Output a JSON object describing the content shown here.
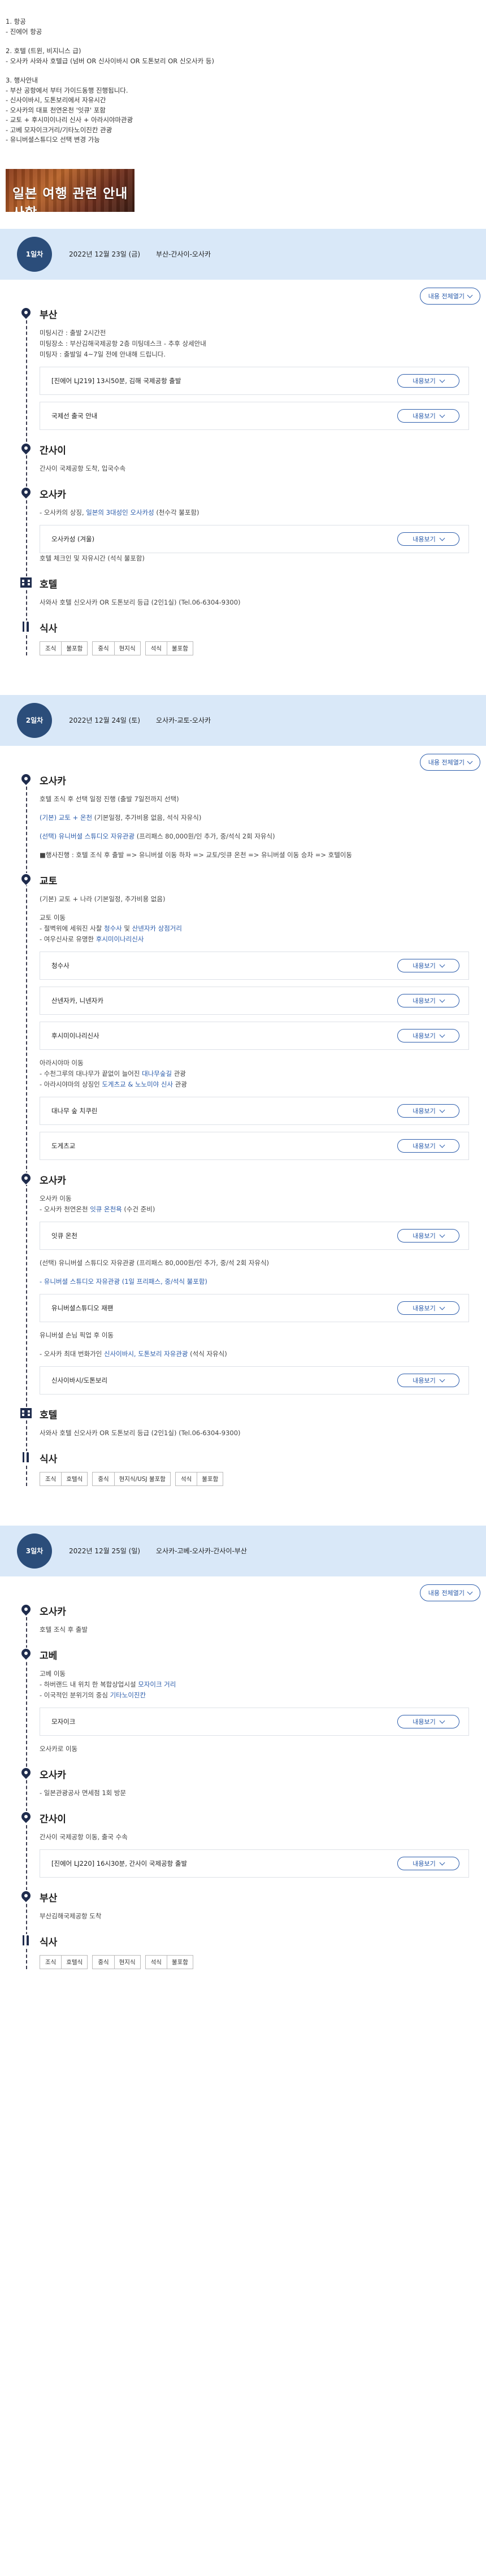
{
  "intro": {
    "lines": [
      "1. 항공",
      "- 진에어 항공",
      "",
      "2. 호텔 (트윈, 비지니스 급)",
      "- 오사카 사와사 호텔급 (넘버 OR 신사이바시 OR 도톤보리 OR 신오사카 등)",
      "",
      "3. 행사안내",
      "- 부산 공항에서 부터 가이드동행 진행됩니다.",
      "- 신사이바시, 도톤보리에서 자유시간",
      "- 오사카의 대표 천연온천 '잇큐' 포함",
      "- 교토 + 후시미이나리 신사 + 아라시야마관광",
      "- 고베 모자이크거리/기타노이진칸 관광",
      "- 유니버셜스튜디오 선택 변경 가능"
    ]
  },
  "notice_banner": {
    "text": "일본 여행 관련 안내사항"
  },
  "expand_all_label": "내용 전체열기",
  "more_label": "내용보기",
  "days": [
    {
      "badge": "1일차",
      "date": "2022년 12월 23일 (금)",
      "route": "부산-간사이-오사카",
      "places": [
        {
          "type": "place",
          "title": "부산",
          "blocks": [
            {
              "kind": "text",
              "lines": [
                "미팅시간 : 출발 2시간전",
                "미팅장소 : 부산김해국제공항 2층 미팅데스크 - 추후 상세안내",
                "미팅자 : 출발일 4~7일 전에 안내해 드립니다."
              ]
            },
            {
              "kind": "box",
              "label": "[진에어 LJ219] 13시50분, 김해 국제공항 출발"
            },
            {
              "kind": "box",
              "label": "국제선 출국 안내"
            }
          ]
        },
        {
          "type": "place",
          "title": "간사이",
          "blocks": [
            {
              "kind": "text",
              "lines": [
                "간사이 국제공항 도착, 입국수속"
              ]
            }
          ]
        },
        {
          "type": "place",
          "title": "오사카",
          "blocks": [
            {
              "kind": "rich",
              "segments": [
                [
                  "- 오사카의 상징, ",
                  ""
                ],
                [
                  "일본의 3대성인 오사카성",
                  "blue"
                ],
                [
                  " (천수각 불포함)",
                  ""
                ]
              ]
            },
            {
              "kind": "box",
              "label": "오사카성 (겨울)"
            },
            {
              "kind": "text",
              "lines": [
                "호텔 체크인 및 자유시간 (석식 불포함)"
              ]
            }
          ]
        },
        {
          "type": "hotel",
          "title": "호텔",
          "blocks": [
            {
              "kind": "text",
              "lines": [
                "사와사 호텔 신오사카 OR 도톤보리 등급 (2인1실) (Tel.06-6304-9300)"
              ]
            }
          ]
        },
        {
          "type": "meal",
          "title": "식사",
          "meals": [
            [
              "조식",
              "불포함"
            ],
            [
              "중식",
              "현지식"
            ],
            [
              "석식",
              "불포함"
            ]
          ]
        }
      ]
    },
    {
      "badge": "2일차",
      "date": "2022년 12월 24일 (토)",
      "route": "오사카-교토-오사카",
      "places": [
        {
          "type": "place",
          "title": "오사카",
          "blocks": [
            {
              "kind": "text",
              "lines": [
                "호텔 조식 후 선택 일정 진행 (출발 7일전까지 선택)"
              ]
            },
            {
              "kind": "rich",
              "gap": true,
              "segments": [
                [
                  "(기본) 교토 + 온천",
                  "blue"
                ],
                [
                  " (기본일정, 추가비용 없음, 석식 자유식)",
                  ""
                ]
              ]
            },
            {
              "kind": "rich",
              "gap": true,
              "segments": [
                [
                  "(선택) 유니버셜 스튜디오 자유관광",
                  "blue"
                ],
                [
                  " (프리패스 80,000원/인 추가, 중/석식 2회 자유식)",
                  ""
                ]
              ]
            },
            {
              "kind": "rich",
              "gap": true,
              "segments": [
                [
                  "■행사진행 : 호텔 조식 후 출발 => 유니버셜 이동 하차 => 교토/잇큐 온천 => 유니버셜 이동 승차 => 호텔이동",
                  ""
                ]
              ]
            }
          ]
        },
        {
          "type": "place",
          "title": "교토",
          "blocks": [
            {
              "kind": "text",
              "lines": [
                "(기본) 교토 + 나라 (기본일정, 추가비용 없음)"
              ]
            },
            {
              "kind": "rich",
              "gap": true,
              "segments": [
                [
                  "교토 이동",
                  ""
                ]
              ]
            },
            {
              "kind": "rich",
              "segments": [
                [
                  "- 절벽위에 세워진 사찰 ",
                  ""
                ],
                [
                  "청수사",
                  "blue"
                ],
                [
                  " 및 ",
                  ""
                ],
                [
                  "산넨자카 상점거리",
                  "blue"
                ]
              ]
            },
            {
              "kind": "rich",
              "segments": [
                [
                  "- 여우신사로 유명한 ",
                  ""
                ],
                [
                  "후시미이나리신사",
                  "blue"
                ]
              ]
            },
            {
              "kind": "box",
              "label": "청수사"
            },
            {
              "kind": "box",
              "label": "산넨자카, 니넨자카"
            },
            {
              "kind": "box",
              "label": "후시미이나리신사"
            },
            {
              "kind": "rich",
              "gap": true,
              "segments": [
                [
                  "아라시야마 이동",
                  ""
                ]
              ]
            },
            {
              "kind": "rich",
              "segments": [
                [
                  "- 수천그루의 대나무가 끝없이 늘어진 ",
                  ""
                ],
                [
                  "대나무숲길",
                  "blue"
                ],
                [
                  " 관광",
                  ""
                ]
              ]
            },
            {
              "kind": "rich",
              "segments": [
                [
                  "- 아라시야마의 상징인 ",
                  ""
                ],
                [
                  "도게츠교 & 노노미야 신사",
                  "blue"
                ],
                [
                  " 관광",
                  ""
                ]
              ]
            },
            {
              "kind": "box",
              "label": "대나무 숲 치쿠린"
            },
            {
              "kind": "box",
              "label": "도게츠교"
            }
          ]
        },
        {
          "type": "place",
          "title": "오사카",
          "blocks": [
            {
              "kind": "text",
              "lines": [
                "오사카 이동"
              ]
            },
            {
              "kind": "rich",
              "segments": [
                [
                  "- 오사카 천연온천 ",
                  ""
                ],
                [
                  "잇큐 온천욕",
                  "blue"
                ],
                [
                  " (수건 준비)",
                  ""
                ]
              ]
            },
            {
              "kind": "box",
              "label": "잇큐 온천"
            },
            {
              "kind": "text",
              "gap": true,
              "lines": [
                "(선택) 유니버셜 스튜디오 자유관광 (프리패스 80,000원/인 추가, 중/석 2회 자유식)"
              ]
            },
            {
              "kind": "rich",
              "gap": true,
              "segments": [
                [
                  "- 유니버셜 스튜디오 자유관광 (1일 프리패스, 중/석식 불포함)",
                  "blue"
                ]
              ]
            },
            {
              "kind": "box",
              "label": "유니버셜스튜디오 재팬"
            },
            {
              "kind": "text",
              "gap": true,
              "lines": [
                "유니버셜 손님 픽업 후 이동"
              ]
            },
            {
              "kind": "rich",
              "gap": true,
              "segments": [
                [
                  "- 오사카 최대 번화가인 ",
                  ""
                ],
                [
                  "신사이바시, 도톤보리 자유관광",
                  "blue"
                ],
                [
                  " (석식 자유식)",
                  ""
                ]
              ]
            },
            {
              "kind": "box",
              "label": "신사이바시/도톤보리"
            }
          ]
        },
        {
          "type": "hotel",
          "title": "호텔",
          "blocks": [
            {
              "kind": "text",
              "lines": [
                "사와사 호텔 신오사카 OR 도톤보리 등급 (2인1실) (Tel.06-6304-9300)"
              ]
            }
          ]
        },
        {
          "type": "meal",
          "title": "식사",
          "meals": [
            [
              "조식",
              "호텔식"
            ],
            [
              "중식",
              "현지식/USJ 불포함"
            ],
            [
              "석식",
              "불포함"
            ]
          ]
        }
      ]
    },
    {
      "badge": "3일차",
      "date": "2022년 12월 25일 (일)",
      "route": "오사카-고베-오사카-간사이-부산",
      "places": [
        {
          "type": "place",
          "title": "오사카",
          "blocks": [
            {
              "kind": "text",
              "lines": [
                "호텔 조식 후 출발"
              ]
            }
          ]
        },
        {
          "type": "place",
          "title": "고베",
          "blocks": [
            {
              "kind": "text",
              "lines": [
                "고베 이동"
              ]
            },
            {
              "kind": "rich",
              "segments": [
                [
                  "- 하버랜드 내 위치 한 복합상업시설 ",
                  ""
                ],
                [
                  "모자이크 거리",
                  "blue"
                ]
              ]
            },
            {
              "kind": "rich",
              "segments": [
                [
                  "- 이국적인 분위기의 중심 ",
                  ""
                ],
                [
                  "기타노이진칸",
                  "blue"
                ]
              ]
            },
            {
              "kind": "box",
              "label": "모자이크"
            },
            {
              "kind": "text",
              "gap": true,
              "lines": [
                "오사카로 이동"
              ]
            }
          ]
        },
        {
          "type": "place",
          "title": "오사카",
          "blocks": [
            {
              "kind": "text",
              "lines": [
                "- 일본관광공사 면세점 1회 방문"
              ]
            }
          ]
        },
        {
          "type": "place",
          "title": "간사이",
          "blocks": [
            {
              "kind": "text",
              "lines": [
                "간사이 국제공항 이동, 출국 수속"
              ]
            },
            {
              "kind": "box",
              "label": "[진에어 LJ220] 16시30분, 간사이 국제공항 출발"
            }
          ]
        },
        {
          "type": "place",
          "title": "부산",
          "blocks": [
            {
              "kind": "text",
              "lines": [
                "부산김해국제공항 도착"
              ]
            }
          ]
        },
        {
          "type": "meal",
          "title": "식사",
          "meals": [
            [
              "조식",
              "호텔식"
            ],
            [
              "중식",
              "현지식"
            ],
            [
              "석식",
              "불포함"
            ]
          ]
        }
      ]
    }
  ]
}
